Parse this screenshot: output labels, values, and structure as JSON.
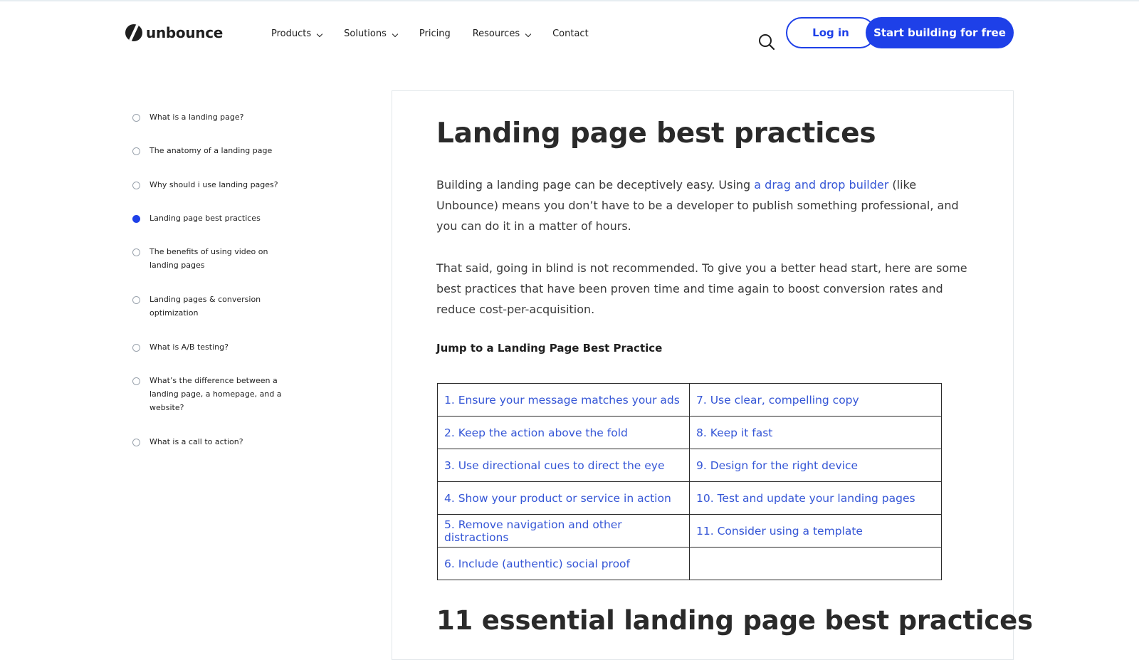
{
  "header": {
    "logo_text": "unbounce",
    "nav": [
      {
        "label": "Products",
        "has_dropdown": true
      },
      {
        "label": "Solutions",
        "has_dropdown": true
      },
      {
        "label": "Pricing",
        "has_dropdown": false
      },
      {
        "label": "Resources",
        "has_dropdown": true
      },
      {
        "label": "Contact",
        "has_dropdown": false
      }
    ],
    "login_label": "Log in",
    "cta_label": "Start building for free"
  },
  "toc": {
    "items": [
      {
        "label": "What is a landing page?",
        "active": false
      },
      {
        "label": "The anatomy of a landing page",
        "active": false
      },
      {
        "label": "Why should i use landing pages?",
        "active": false
      },
      {
        "label": "Landing page best practices",
        "active": true
      },
      {
        "label": "The benefits of using video on landing pages",
        "active": false
      },
      {
        "label": "Landing pages & conversion optimization",
        "active": false
      },
      {
        "label": "What is A/B testing?",
        "active": false
      },
      {
        "label": "What’s the difference between a landing page, a homepage, and a website?",
        "active": false
      },
      {
        "label": "What is a call to action?",
        "active": false
      }
    ]
  },
  "article": {
    "title": "Landing page best practices",
    "para1_before": "Building a landing page can be deceptively easy. Using ",
    "para1_link": "a drag and drop builder",
    "para1_after": " (like Unbounce) means you don’t have to be a developer to publish something professional, and you can do it in a matter of hours.",
    "para2": "That said, going in blind is not recommended. To give you a better head start, here are some best practices that have been proven time and time again to boost conversion rates and reduce cost-per-acquisition.",
    "jump_heading": "Jump to a Landing Page Best Practice",
    "practices_left": [
      "1. Ensure your message matches your ads",
      "2. Keep the action above the fold",
      "3. Use directional cues to direct the eye",
      "4. Show your product or service in action",
      "5. Remove navigation and other distractions",
      "6. Include (authentic) social proof"
    ],
    "practices_right": [
      "7. Use clear, compelling copy",
      "8. Keep it fast",
      "9. Design for the right device",
      "10. Test and update your landing pages",
      "11. Consider using a template",
      ""
    ],
    "section_heading": "11 essential landing page best practices"
  },
  "colors": {
    "brand_blue": "#1e40e8",
    "link_blue": "#3556d6",
    "text": "#1f1f1f"
  }
}
